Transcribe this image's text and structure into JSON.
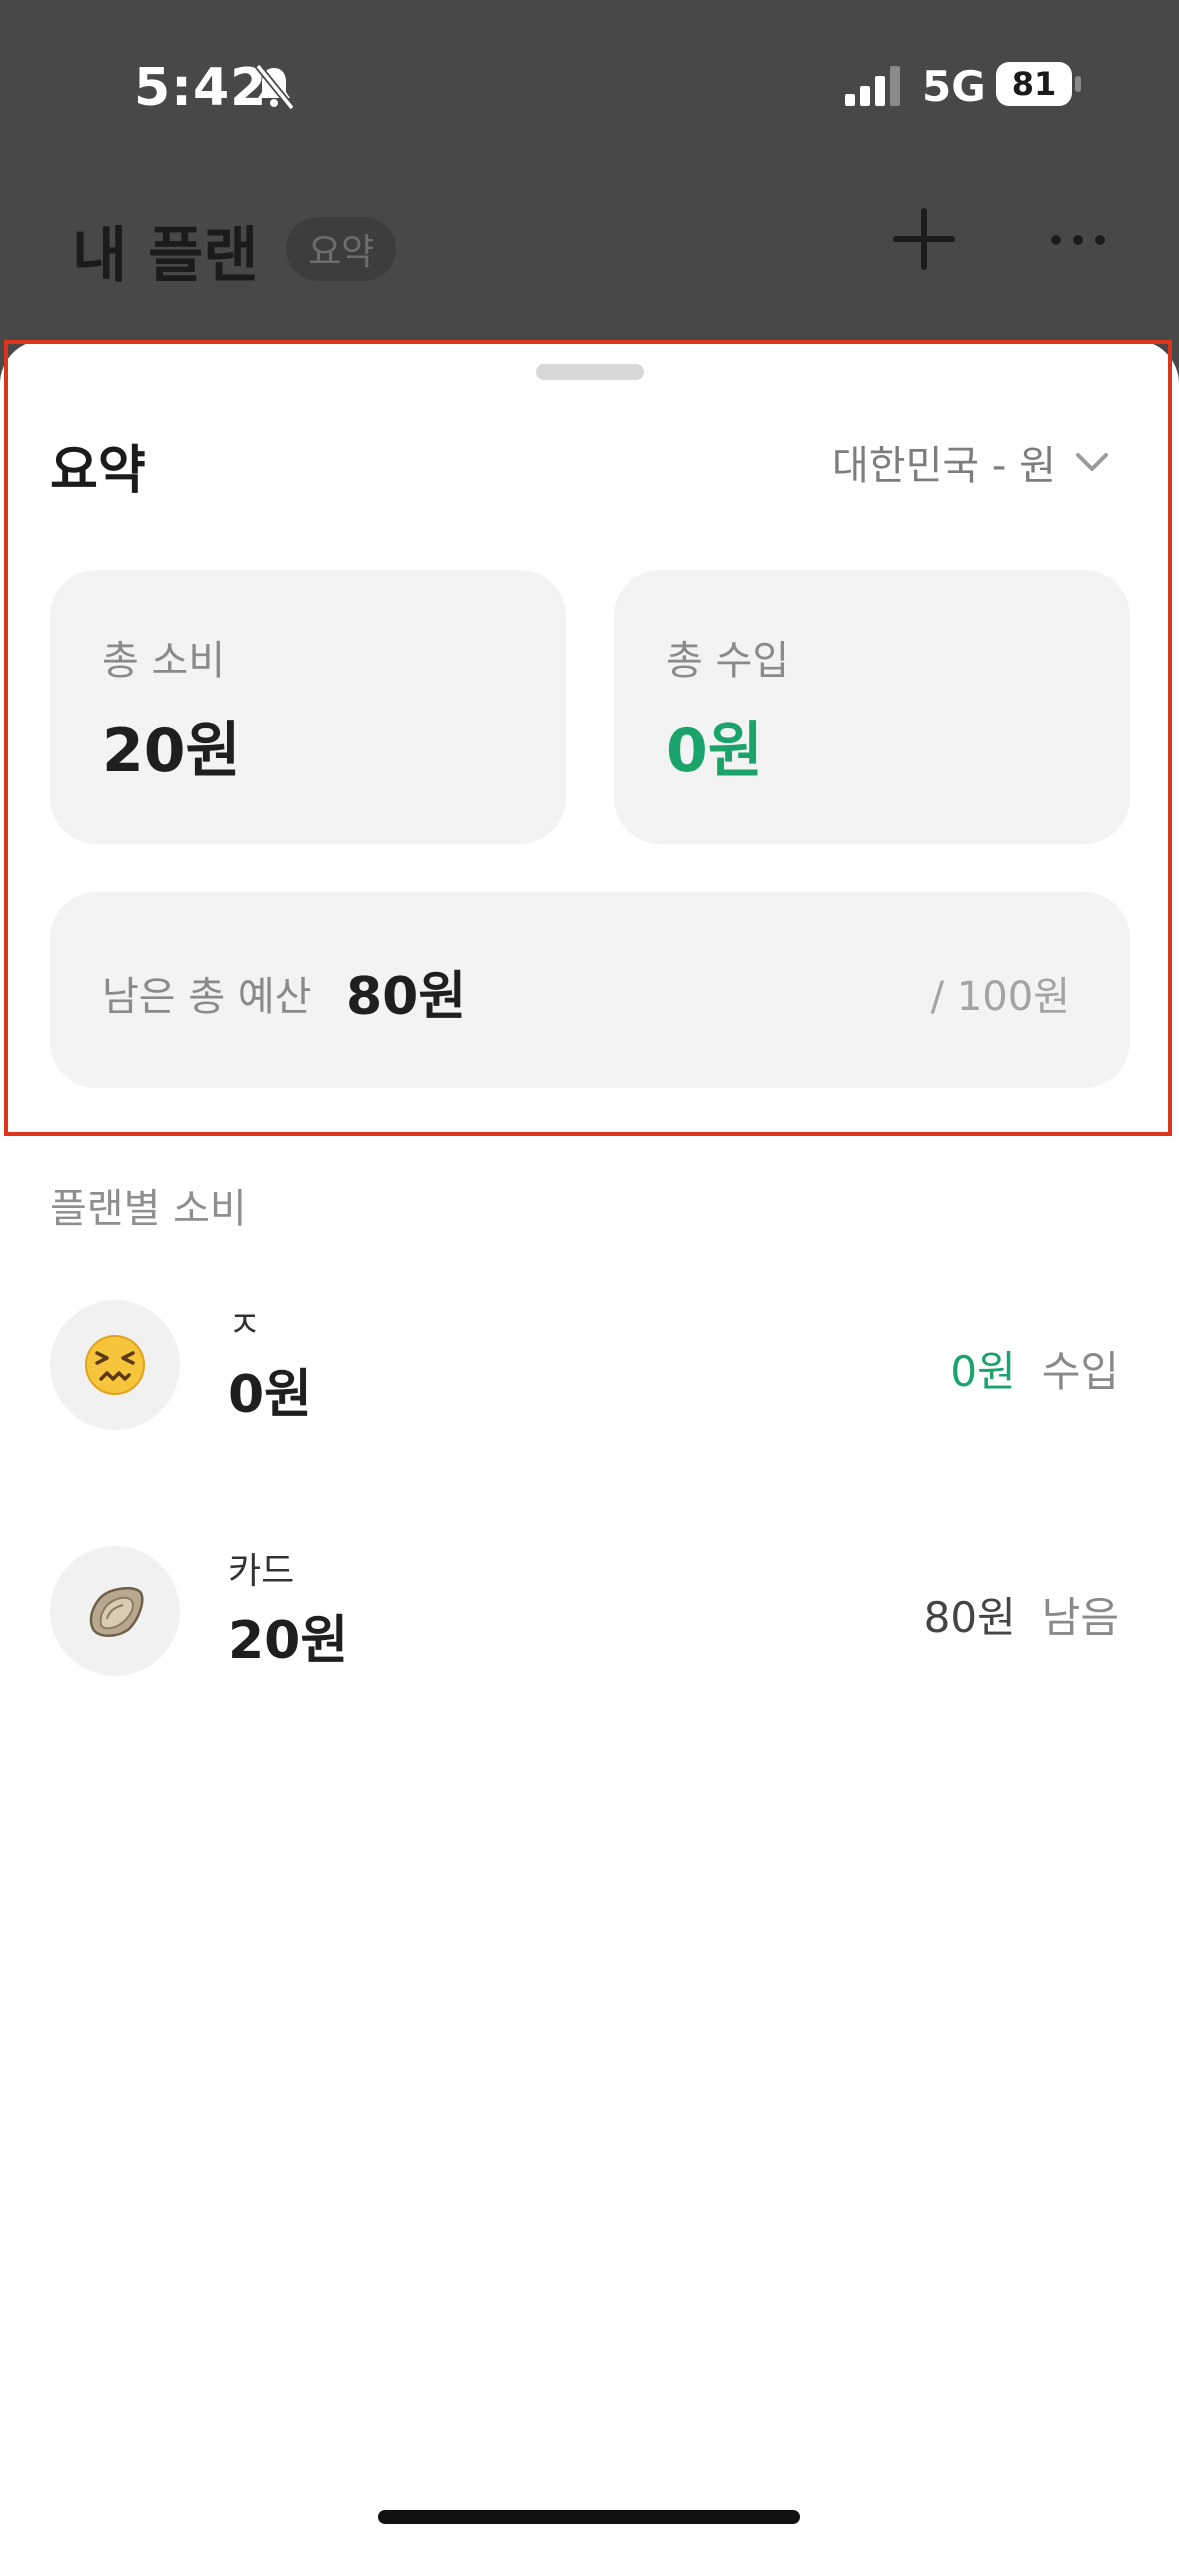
{
  "status_bar": {
    "time": "5:42",
    "network": "5G",
    "battery": "81"
  },
  "header": {
    "title": "내 플랜",
    "badge": "요약"
  },
  "summary": {
    "title": "요약",
    "currency": "대한민국 - 원",
    "total_spend_label": "총 소비",
    "total_spend_value": "20원",
    "total_income_label": "총 수입",
    "total_income_value": "0원",
    "remaining_label": "남은 총 예산",
    "remaining_value": "80원",
    "budget_total": "/ 100원"
  },
  "plans": {
    "section_label": "플랜별 소비",
    "items": [
      {
        "name": "ㅈ",
        "amount": "0원",
        "right_value": "0원",
        "right_label": "수입",
        "icon": "confounded-face-emoji"
      },
      {
        "name": "카드",
        "amount": "20원",
        "right_value": "80원",
        "right_label": "남음",
        "icon": "oyster-emoji"
      }
    ]
  },
  "colors": {
    "accent_green": "#1aa36b",
    "highlight": "#e0331c",
    "dim_background": "#484848"
  }
}
